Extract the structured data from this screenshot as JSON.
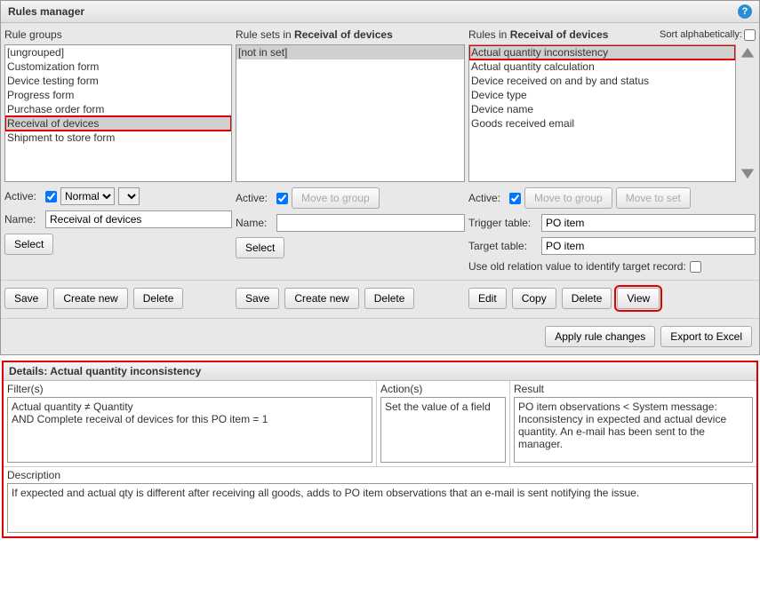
{
  "window": {
    "title": "Rules manager"
  },
  "ruleGroups": {
    "header": "Rule groups",
    "items": [
      "[ungrouped]",
      "Customization form",
      "Device testing form",
      "Progress form",
      "Purchase order form",
      "Receival of devices",
      "Shipment to store form"
    ],
    "selectedIndex": 5,
    "activeLabel": "Active:",
    "dropdown": "Normal",
    "nameLabel": "Name:",
    "nameValue": "Receival of devices",
    "selectBtn": "Select",
    "saveBtn": "Save",
    "createBtn": "Create new",
    "deleteBtn": "Delete"
  },
  "ruleSets": {
    "headerPrefix": "Rule sets in ",
    "headerBold": "Receival of devices",
    "items": [
      "[not in set]"
    ],
    "selectedIndex": 0,
    "activeLabel": "Active:",
    "moveBtn": "Move to group",
    "nameLabel": "Name:",
    "nameValue": "",
    "selectBtn": "Select",
    "saveBtn": "Save",
    "createBtn": "Create new",
    "deleteBtn": "Delete"
  },
  "rules": {
    "headerPrefix": "Rules in ",
    "headerBold": "Receival of devices",
    "sortLabel": "Sort alphabetically:",
    "items": [
      "Actual quantity inconsistency",
      "Actual quantity calculation",
      "Device received on and by and status",
      "Device type",
      "Device name",
      "Goods received email"
    ],
    "selectedIndex": 0,
    "activeLabel": "Active:",
    "moveGroupBtn": "Move to group",
    "moveSetBtn": "Move to set",
    "triggerLabel": "Trigger table:",
    "triggerValue": "PO item",
    "targetLabel": "Target table:",
    "targetValue": "PO item",
    "oldRelLabel": "Use old relation value to identify target record:",
    "editBtn": "Edit",
    "copyBtn": "Copy",
    "deleteBtn": "Delete",
    "viewBtn": "View"
  },
  "footer": {
    "applyBtn": "Apply rule changes",
    "exportBtn": "Export to Excel"
  },
  "details": {
    "headerPrefix": "Details: ",
    "headerName": "Actual quantity inconsistency",
    "filtersLabel": "Filter(s)",
    "filtersText": "Actual quantity ≠ Quantity\nAND Complete receival of devices for this PO item = 1",
    "actionsLabel": "Action(s)",
    "actionsText": "Set the value of a field",
    "resultLabel": "Result",
    "resultText": "PO item observations < System message: Inconsistency in expected and actual device quantity. An e-mail has been sent to the manager.",
    "descLabel": "Description",
    "descText": "If expected and actual qty is different after receiving all goods, adds to PO item observations that an e-mail is sent notifying the issue."
  }
}
